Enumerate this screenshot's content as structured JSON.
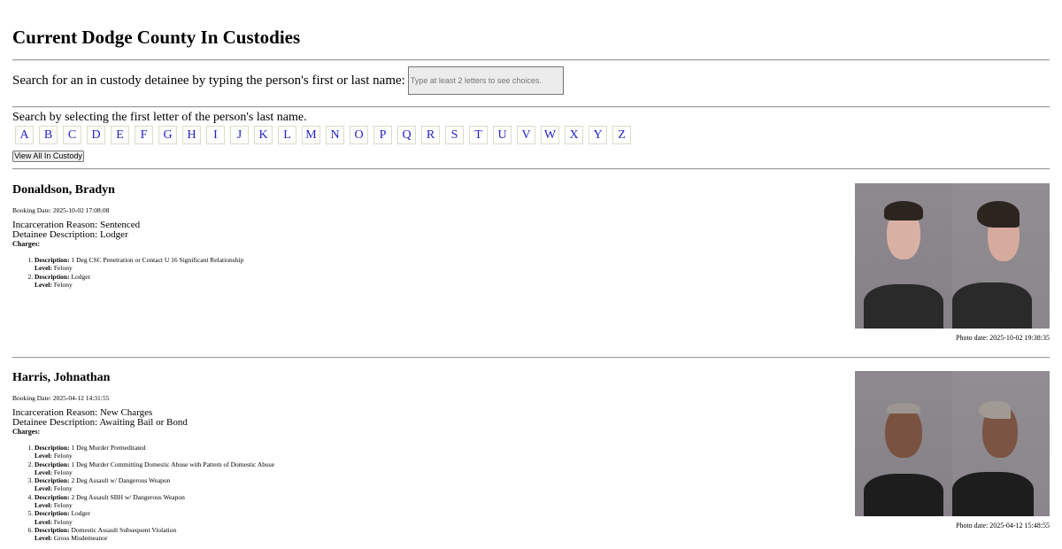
{
  "page": {
    "title": "Current Dodge County In Custodies"
  },
  "search": {
    "label": "Search for an in custody detainee by typing the person's first or last name:",
    "placeholder": "Type at least 2 letters to see choices.",
    "value": ""
  },
  "letters": {
    "label": "Search by selecting the first letter of the person's last name.",
    "items": [
      "A",
      "B",
      "C",
      "D",
      "E",
      "F",
      "G",
      "H",
      "I",
      "J",
      "K",
      "L",
      "M",
      "N",
      "O",
      "P",
      "Q",
      "R",
      "S",
      "T",
      "U",
      "V",
      "W",
      "X",
      "Y",
      "Z"
    ]
  },
  "view_all_label": "View All In Custody",
  "detainees": [
    {
      "name": "Donaldson, Bradyn",
      "booking_date": "Booking Date: 2025-10-02 17:08:08",
      "incarceration_reason": "Incarceration Reason: Sentenced",
      "detainee_description": "Detainee Description: Lodger",
      "charges_label": "Charges:",
      "charges": [
        {
          "desc_label": "Description:",
          "desc": "1 Deg CSC Penetration or Contact U 16 Significant Relationship",
          "level_label": "Level:",
          "level": "Felony"
        },
        {
          "desc_label": "Description:",
          "desc": "Lodger",
          "level_label": "Level:",
          "level": "Felony"
        }
      ],
      "photo_date": "Photo date: 2025-10-02 19:38:35"
    },
    {
      "name": "Harris, Johnathan",
      "booking_date": "Booking Date: 2025-04-12 14:31:55",
      "incarceration_reason": "Incarceration Reason: New Charges",
      "detainee_description": "Detainee Description: Awaiting Bail or Bond",
      "charges_label": "Charges:",
      "charges": [
        {
          "desc_label": "Description:",
          "desc": "1 Deg Murder Premeditated",
          "level_label": "Level:",
          "level": "Felony"
        },
        {
          "desc_label": "Description:",
          "desc": "1 Deg Murder Committing Domestic Abuse with Pattern of Domestic Abuse",
          "level_label": "Level:",
          "level": "Felony"
        },
        {
          "desc_label": "Description:",
          "desc": "2 Deg Assault w/ Dangerous Weapon",
          "level_label": "Level:",
          "level": "Felony"
        },
        {
          "desc_label": "Description:",
          "desc": "2 Deg Assault SBH w/ Dangerous Weapon",
          "level_label": "Level:",
          "level": "Felony"
        },
        {
          "desc_label": "Description:",
          "desc": "Lodger",
          "level_label": "Level:",
          "level": "Felony"
        },
        {
          "desc_label": "Description:",
          "desc": "Domestic Assault Subsequent Violation",
          "level_label": "Level:",
          "level": "Gross Misdemeanor"
        }
      ],
      "photo_date": "Photo date: 2025-04-12 15:48:55"
    }
  ]
}
